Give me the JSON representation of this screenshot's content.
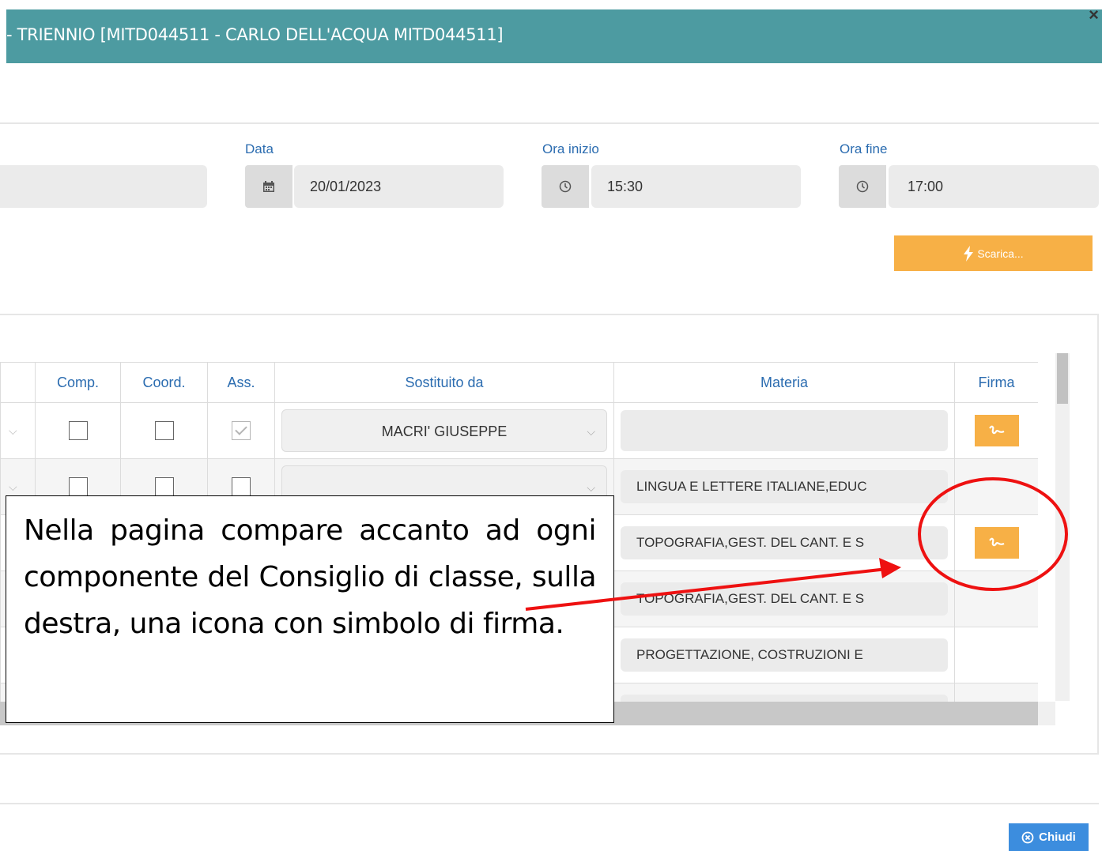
{
  "header": {
    "title": "- TRIENNIO [MITD044511 - CARLO DELL'ACQUA MITD044511]",
    "close_icon": "×"
  },
  "form": {
    "date": {
      "label": "Data",
      "value": "20/01/2023"
    },
    "start_time": {
      "label": "Ora inizio",
      "value": "15:30"
    },
    "end_time": {
      "label": "Ora fine",
      "value": "17:00"
    }
  },
  "scarica_button": {
    "label": "Scarica..."
  },
  "table": {
    "columns": [
      "Comp.",
      "Coord.",
      "Ass.",
      "Sostituito da",
      "Materia",
      "Firma"
    ],
    "rows": [
      {
        "comp": false,
        "coord": false,
        "ass": true,
        "sostituito": "MACRI' GIUSEPPE",
        "materia": "",
        "firma": true
      },
      {
        "comp": false,
        "coord": false,
        "ass": false,
        "sostituito": "",
        "materia": "LINGUA E LETTERE ITALIANE,EDUC",
        "firma": false
      },
      {
        "materia": "TOPOGRAFIA,GEST. DEL CANT. E S",
        "firma": true
      },
      {
        "materia": "TOPOGRAFIA,GEST. DEL CANT. E S",
        "firma": false
      },
      {
        "materia": "PROGETTAZIONE, COSTRUZIONI E",
        "firma": false
      },
      {
        "materia": "",
        "firma": false
      }
    ]
  },
  "annotation": {
    "text": "Nella pagina compare accanto ad ogni componente del Consiglio di classe, sulla destra, una icona con simbolo di firma."
  },
  "footer": {
    "chiudi_label": "Chiudi"
  },
  "colors": {
    "header": "#4d9ba1",
    "accent_orange": "#f7b046",
    "primary_blue": "#3c8dde",
    "annotation_red": "#ee1111"
  },
  "icons": [
    "close-icon",
    "calendar-icon",
    "clock-icon",
    "bolt-icon",
    "signature-icon",
    "close-circle-icon"
  ]
}
